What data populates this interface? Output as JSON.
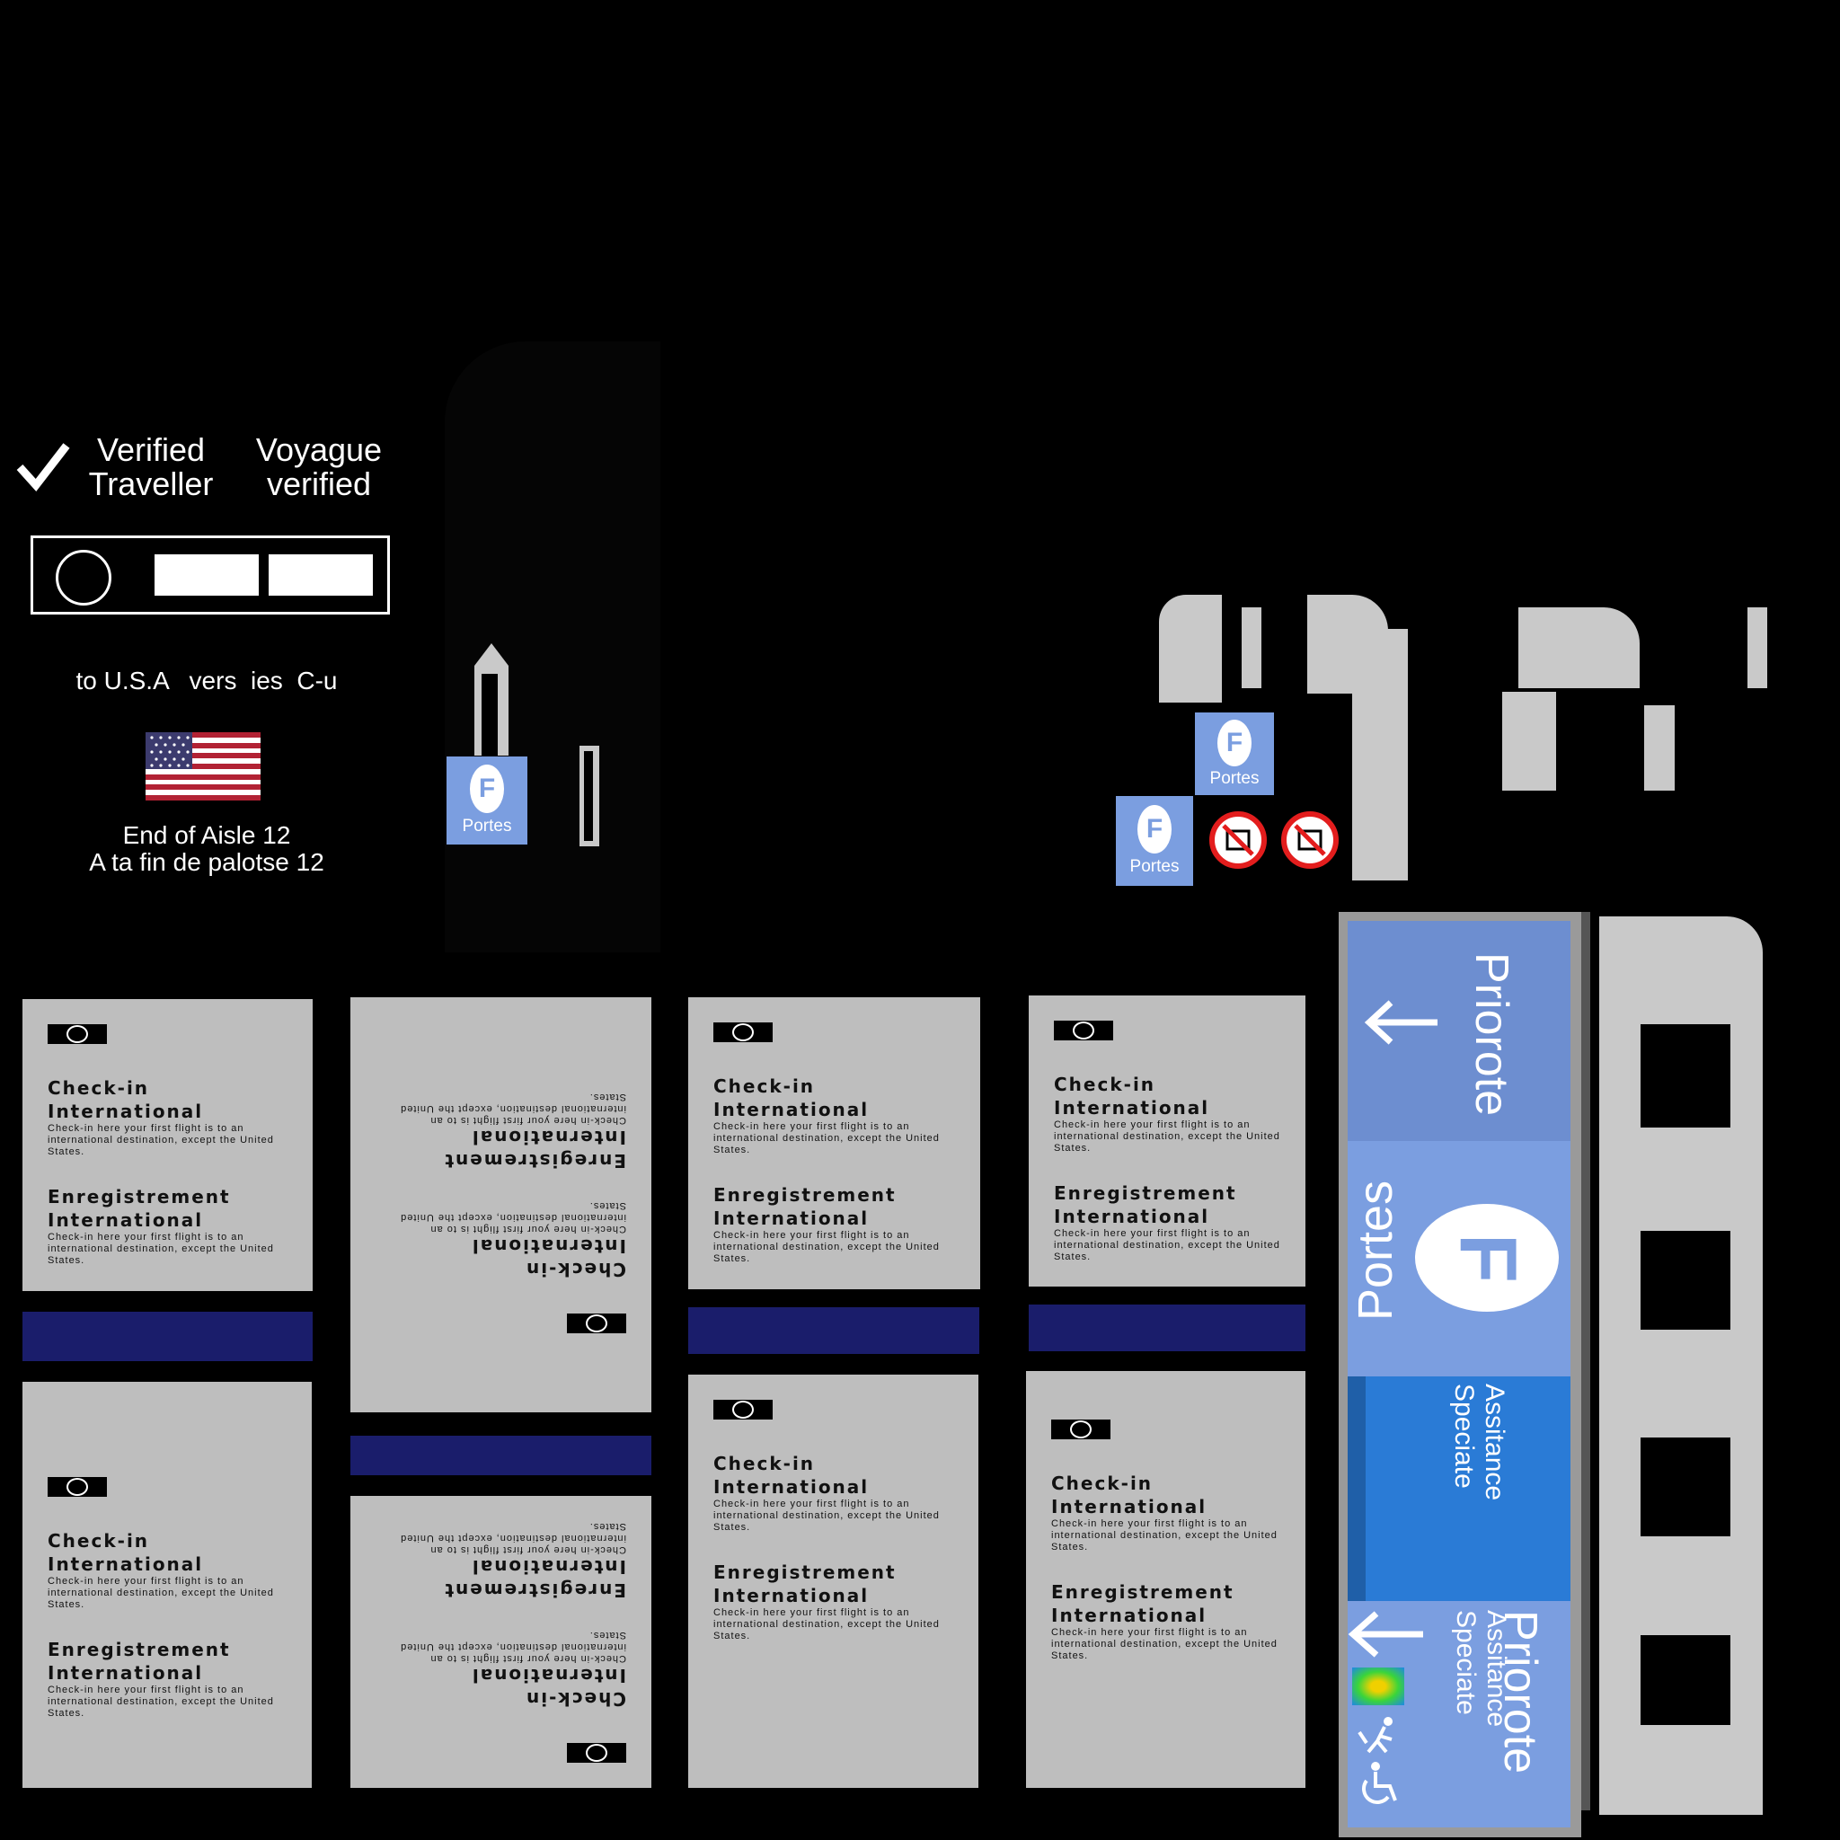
{
  "verified": {
    "check_icon": "checkmark-icon",
    "en_line1": "Verified",
    "en_line2": "Traveller",
    "fr_line1": "Voyague",
    "fr_line2": "verified"
  },
  "destination": {
    "label": "to U.S.A   vers  ies  C-u",
    "aisle_en": "End of Aisle 12",
    "aisle_fr": "A ta fin de palotse 12"
  },
  "gate_badges": {
    "letter": "F",
    "label": "Portes"
  },
  "panel": {
    "h1a": "Check-in",
    "h1b": "International",
    "body": "Check-in here your first flight is to an international destination, except the United States.",
    "h2a": "Enregistrement",
    "h2b": "International"
  },
  "sign": {
    "priority": "Priorote",
    "gate_letter": "F",
    "gates": "Portes",
    "assist": "Assitance Speciate",
    "priority2": "Priorote",
    "assist2": "Assitance Speciate"
  },
  "colors": {
    "navy": "#1a1d6b",
    "gate_blue": "#7b9ee0",
    "sign_dark_blue": "#6d8ed0",
    "sign_mid_blue": "#2a7bd6",
    "no_red": "#e31d1d"
  }
}
